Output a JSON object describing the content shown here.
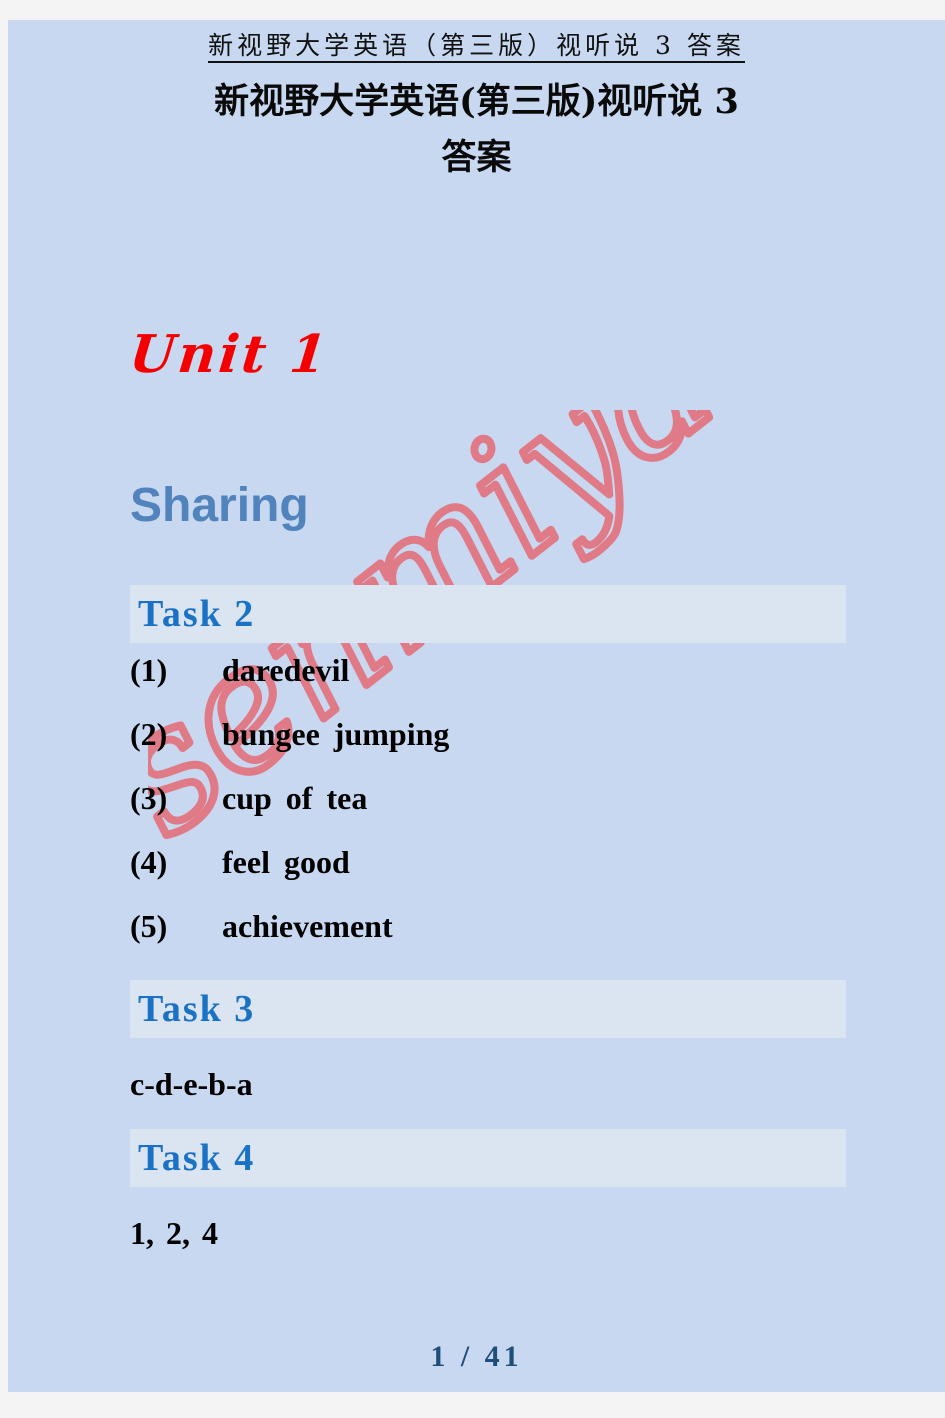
{
  "page": {
    "running_header": "新视野大学英语（第三版）视听说 3 答案",
    "title_line1": "新视野大学英语(第三版)视听说 3",
    "title_line2": "答案",
    "watermark_text": "senmiyao",
    "background_color": "#c7d8f0",
    "canvas_color": "#f4f4f5"
  },
  "unit": {
    "label": "Unit 1",
    "color": "#f50000"
  },
  "section": {
    "label": "Sharing",
    "color": "#5183bd"
  },
  "tasks": [
    {
      "label": "Task  2",
      "type": "numbered",
      "items": [
        {
          "number": "(1)",
          "text": "daredevil"
        },
        {
          "number": "(2)",
          "text": "bungee  jumping"
        },
        {
          "number": "(3)",
          "text": "cup  of  tea"
        },
        {
          "number": "(4)",
          "text": "feel  good"
        },
        {
          "number": "(5)",
          "text": "achievement"
        }
      ]
    },
    {
      "label": "Task  3",
      "type": "plain",
      "answer": "c-d-e-b-a"
    },
    {
      "label": "Task  4",
      "type": "plain",
      "answer": "1,  2,  4"
    }
  ],
  "footer": {
    "current_page": "1",
    "separator": "/",
    "total_pages": "41",
    "text": "1  /  41"
  }
}
